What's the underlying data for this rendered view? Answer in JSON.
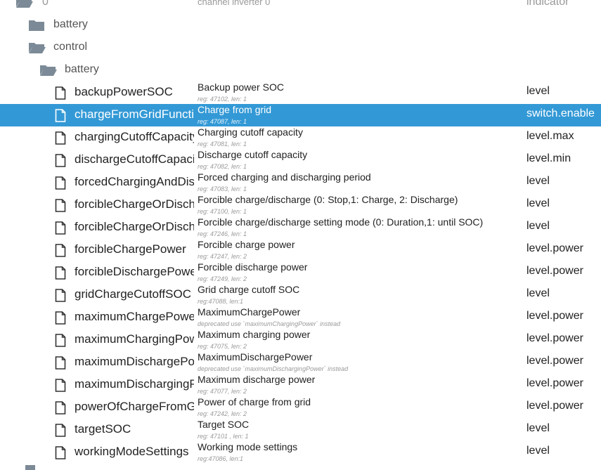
{
  "top_row": {
    "name": "0",
    "title": "channel inverter 0",
    "role": "indicator"
  },
  "folders": [
    {
      "name": "battery"
    },
    {
      "name": "control"
    },
    {
      "name": "battery"
    }
  ],
  "rows": [
    {
      "name": "backupPowerSOC",
      "title": "Backup power SOC",
      "sub": "reg: 47102, len: 1",
      "role": "level"
    },
    {
      "name": "chargeFromGridFunction",
      "title": "Charge from grid",
      "sub": "reg: 47087, len: 1",
      "role": "switch.enable",
      "selected": true
    },
    {
      "name": "chargingCutoffCapacity",
      "title": "Charging cutoff capacity",
      "sub": "reg: 47081, len: 1",
      "role": "level.max"
    },
    {
      "name": "dischargeCutoffCapacity",
      "title": "Discharge cutoff capacity",
      "sub": "reg: 47082, len: 1",
      "role": "level.min"
    },
    {
      "name": "forcedChargingAndDischargingPeriod",
      "title": "Forced charging and discharging period",
      "sub": "reg: 47083, len: 1",
      "role": "level"
    },
    {
      "name": "forcibleChargeOrDischarge",
      "title": "Forcible charge/discharge (0: Stop,1: Charge, 2: Discharge)",
      "sub": "reg: 47100, len: 1",
      "role": "level"
    },
    {
      "name": "forcibleChargeOrDischargeSettingMode",
      "title": "Forcible charge/discharge setting mode (0: Duration,1: until SOC)",
      "sub": "reg: 47246, len: 1",
      "role": "level"
    },
    {
      "name": "forcibleChargePower",
      "title": "Forcible charge power",
      "sub": "reg: 47247, len: 2",
      "role": "level.power"
    },
    {
      "name": "forcibleDischargePower",
      "title": "Forcible discharge power",
      "sub": "reg: 47249, len: 2",
      "role": "level.power"
    },
    {
      "name": "gridChargeCutoffSOC",
      "title": "Grid charge cutoff SOC",
      "sub": "reg:47088, len:1",
      "role": "level"
    },
    {
      "name": "maximumChargePower",
      "title": "MaximumChargePower",
      "sub": "deprecated use `maximumChargingPower` instead",
      "role": "level.power"
    },
    {
      "name": "maximumChargingPower",
      "title": "Maximum charging power",
      "sub": "reg: 47075, len: 2",
      "role": "level.power"
    },
    {
      "name": "maximumDischargePower",
      "title": "MaximumDischargePower",
      "sub": "deprecated use `maximumDischargingPower` instead",
      "role": "level.power"
    },
    {
      "name": "maximumDischargingPower",
      "title": "Maximum discharge power",
      "sub": "reg: 47077, len: 2",
      "role": "level.power"
    },
    {
      "name": "powerOfChargeFromGrid",
      "title": "Power of charge from grid",
      "sub": "reg: 47242, len: 2",
      "role": "level.power"
    },
    {
      "name": "targetSOC",
      "title": "Target SOC",
      "sub": "reg: 47101 , len: 1",
      "role": "level"
    },
    {
      "name": "workingModeSettings",
      "title": "Working mode settings",
      "sub": "reg:47086, len:1",
      "role": "level"
    }
  ],
  "colors": {
    "selected_bg": "#3399d6",
    "folder": "#7b8a96"
  }
}
